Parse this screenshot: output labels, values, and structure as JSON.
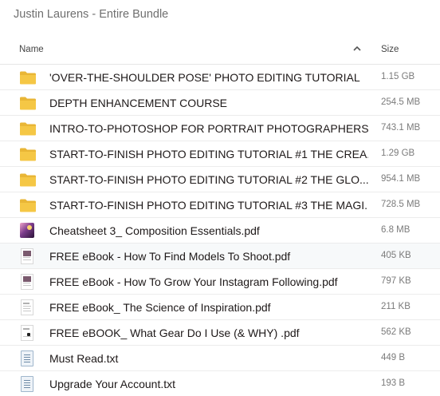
{
  "window": {
    "title": "Justin Laurens - Entire Bundle"
  },
  "header": {
    "name_label": "Name",
    "size_label": "Size",
    "sort_icon": "chevron-up-icon"
  },
  "colors": {
    "folder": "#f5c745",
    "folder_dark": "#e9b636",
    "hover_row": "#f7f9fa"
  },
  "files": [
    {
      "name": "'OVER-THE-SHOULDER POSE' PHOTO EDITING TUTORIAL",
      "size": "1.15 GB",
      "type": "folder"
    },
    {
      "name": "DEPTH ENHANCEMENT COURSE",
      "size": "254.5 MB",
      "type": "folder"
    },
    {
      "name": "INTRO-TO-PHOTOSHOP FOR PORTRAIT PHOTOGRAPHERS",
      "size": "743.1 MB",
      "type": "folder"
    },
    {
      "name": "START-TO-FINISH PHOTO EDITING TUTORIAL #1 THE CREA...",
      "size": "1.29 GB",
      "type": "folder"
    },
    {
      "name": "START-TO-FINISH PHOTO EDITING TUTORIAL #2 THE GLO...",
      "size": "954.1 MB",
      "type": "folder"
    },
    {
      "name": "START-TO-FINISH PHOTO EDITING TUTORIAL #3 THE MAGI...",
      "size": "728.5 MB",
      "type": "folder"
    },
    {
      "name": "Cheatsheet 3_ Composition Essentials.pdf",
      "size": "6.8 MB",
      "type": "pdf-image"
    },
    {
      "name": "FREE eBook - How To Find Models To Shoot.pdf",
      "size": "405 KB",
      "type": "pdf"
    },
    {
      "name": "FREE eBook - How To Grow Your Instagram Following.pdf",
      "size": "797 KB",
      "type": "pdf"
    },
    {
      "name": "FREE eBook_ The Science of Inspiration.pdf",
      "size": "211 KB",
      "type": "pdf"
    },
    {
      "name": "FREE eBOOK_ What Gear Do I Use (& WHY) .pdf",
      "size": "562 KB",
      "type": "pdf"
    },
    {
      "name": "Must Read.txt",
      "size": "449 B",
      "type": "txt"
    },
    {
      "name": "Upgrade Your Account.txt",
      "size": "193 B",
      "type": "txt"
    }
  ]
}
